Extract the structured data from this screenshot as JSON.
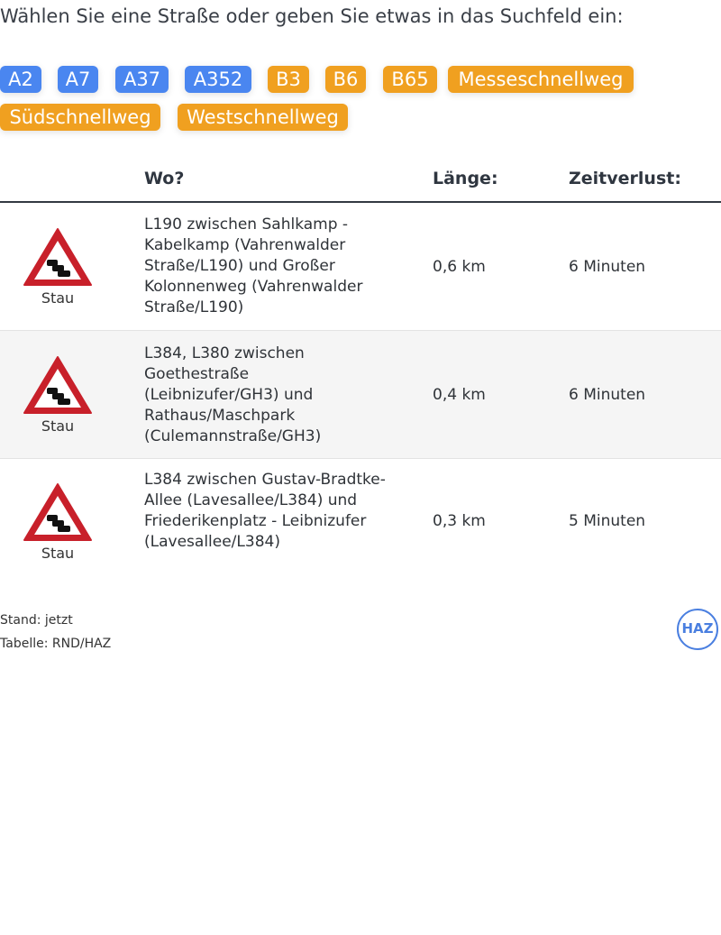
{
  "intro": "Wählen Sie eine Straße oder geben Sie etwas in das Suchfeld ein:",
  "chips": [
    {
      "label": "A2",
      "color": "#4a86f0"
    },
    {
      "label": "A7",
      "color": "#4a86f0"
    },
    {
      "label": "A37",
      "color": "#4a86f0"
    },
    {
      "label": "A352",
      "color": "#4a86f0"
    },
    {
      "label": "B3",
      "color": "#f0a020"
    },
    {
      "label": "B6",
      "color": "#f0a020"
    },
    {
      "label": "B65",
      "color": "#f0a020"
    },
    {
      "label": "Messeschnellweg",
      "color": "#f0a020"
    },
    {
      "label": "Südschnellweg",
      "color": "#f0a020"
    },
    {
      "label": "Westschnellweg",
      "color": "#f0a020"
    }
  ],
  "table": {
    "headers": {
      "where": "Wo?",
      "length": "Länge:",
      "loss": "Zeitverlust:"
    },
    "rows": [
      {
        "icon": "traffic-jam-warning-icon",
        "type": "Stau",
        "where": "L190 zwischen Sahlkamp - Kabelkamp (Vahrenwalder Straße/L190) und Großer Kolonnenweg (Vahrenwalder Straße/L190)",
        "length": "0,6 km",
        "loss": "6 Minuten"
      },
      {
        "icon": "traffic-jam-warning-icon",
        "type": "Stau",
        "where": "L384, L380 zwischen Goethestraße (Leibnizufer/GH3) und Rathaus/Maschpark (Culemannstraße/GH3)",
        "length": "0,4 km",
        "loss": "6 Minuten"
      },
      {
        "icon": "traffic-jam-warning-icon",
        "type": "Stau",
        "where": "L384 zwischen Gustav-Bradtke-Allee (Lavesallee/L384) und Friederikenplatz - Leibnizufer (Lavesallee/L384)",
        "length": "0,3 km",
        "loss": "5 Minuten"
      }
    ]
  },
  "footer": {
    "status": "Stand: jetzt",
    "source": "Tabelle: RND/HAZ"
  },
  "logo": "HAZ"
}
